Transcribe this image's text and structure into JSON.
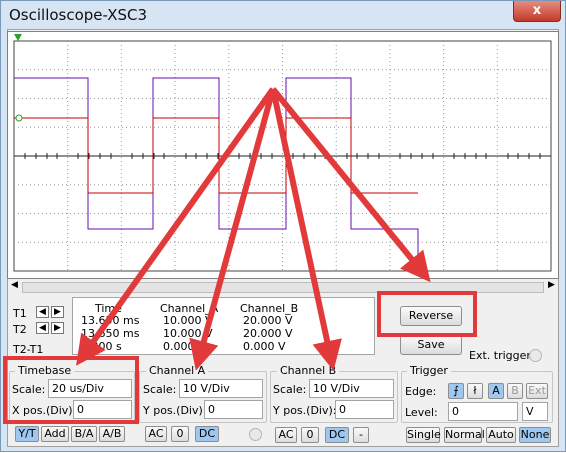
{
  "window": {
    "title": "Oscilloscope-XSC3",
    "close_label": "x"
  },
  "cursor_labels": {
    "t1": "T1",
    "t2": "T2",
    "t2t1": "T2-T1"
  },
  "readout": {
    "headers": {
      "time": "Time",
      "ch_a": "Channel_A",
      "ch_b": "Channel_B"
    },
    "rows": [
      {
        "time": "13.650 ms",
        "ch_a": "10.000 V",
        "ch_b": "20.000 V"
      },
      {
        "time": "13.650 ms",
        "ch_a": "10.000 V",
        "ch_b": "20.000 V"
      },
      {
        "time": "0.000 s",
        "ch_a": "0.000 V",
        "ch_b": "0.000 V"
      }
    ]
  },
  "buttons": {
    "reverse": "Reverse",
    "save": "Save",
    "ext_trigger": "Ext. trigger"
  },
  "timebase": {
    "title": "Timebase",
    "scale_label": "Scale:",
    "scale_value": "20 us/Div",
    "xpos_label": "X pos.(Div):",
    "xpos_value": "0",
    "modes": [
      "Y/T",
      "Add",
      "B/A",
      "A/B"
    ]
  },
  "channel_a": {
    "title": "Channel A",
    "scale_label": "Scale:",
    "scale_value": "10  V/Div",
    "ypos_label": "Y pos.(Div):",
    "ypos_value": "0",
    "coupling": [
      "AC",
      "0",
      "DC"
    ]
  },
  "channel_b": {
    "title": "Channel B",
    "scale_label": "Scale:",
    "scale_value": "10  V/Div",
    "ypos_label": "Y pos.(Div):",
    "ypos_value": "0",
    "coupling": [
      "AC",
      "0",
      "DC",
      "-"
    ]
  },
  "trigger": {
    "title": "Trigger",
    "edge_label": "Edge:",
    "edge_buttons": [
      "A",
      "B",
      "Ext"
    ],
    "level_label": "Level:",
    "level_value": "0",
    "level_unit": "V",
    "modes": [
      "Single",
      "Normal",
      "Auto",
      "None"
    ]
  },
  "colors": {
    "trace_a": "#c00000",
    "trace_b": "#6a0fa8",
    "annotation": "#e23a3a",
    "selected_mode": "#9ec8ef"
  }
}
